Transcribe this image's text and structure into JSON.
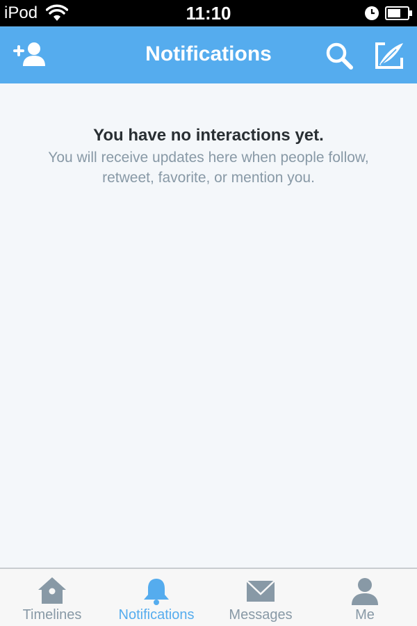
{
  "status_bar": {
    "carrier": "iPod",
    "time": "11:10"
  },
  "nav": {
    "title": "Notifications",
    "left_icon": "add-user-icon",
    "right_icons": [
      "search-icon",
      "compose-icon"
    ]
  },
  "empty_state": {
    "title": "You have no interactions yet.",
    "subtitle": "You will receive updates here when people follow, retweet, favorite, or mention you."
  },
  "tabs": [
    {
      "label": "Timelines",
      "icon": "home-icon",
      "active": false
    },
    {
      "label": "Notifications",
      "icon": "bell-icon",
      "active": true
    },
    {
      "label": "Messages",
      "icon": "envelope-icon",
      "active": false
    },
    {
      "label": "Me",
      "icon": "person-icon",
      "active": false
    }
  ],
  "colors": {
    "brand": "#55acee",
    "inactive": "#8899a6",
    "background": "#f4f7fa",
    "text_dark": "#292f33"
  }
}
